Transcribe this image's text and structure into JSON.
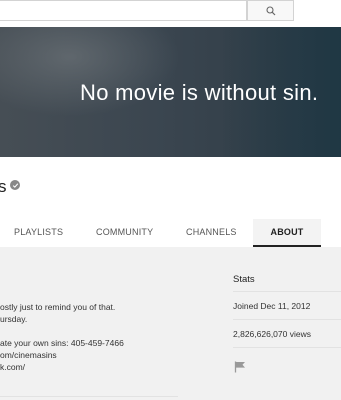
{
  "search": {
    "placeholder": "",
    "icon": "search-icon"
  },
  "banner": {
    "tagline": "No movie is without sin."
  },
  "channel": {
    "name_fragment": "s",
    "verified_icon": "check-badge-icon"
  },
  "tabs": [
    {
      "label": "PLAYLISTS",
      "active": false
    },
    {
      "label": "COMMUNITY",
      "active": false
    },
    {
      "label": "CHANNELS",
      "active": false
    },
    {
      "label": "ABOUT",
      "active": true
    }
  ],
  "about": {
    "description_lines": [
      "ostly just to remind you of that.",
      "ursday.",
      "ate your own sins: 405-459-7466",
      "om/cinemasins",
      "k.com/"
    ]
  },
  "stats": {
    "title": "Stats",
    "joined": "Joined Dec 11, 2012",
    "views": "2,826,626,070 views",
    "flag_icon": "flag-icon"
  }
}
